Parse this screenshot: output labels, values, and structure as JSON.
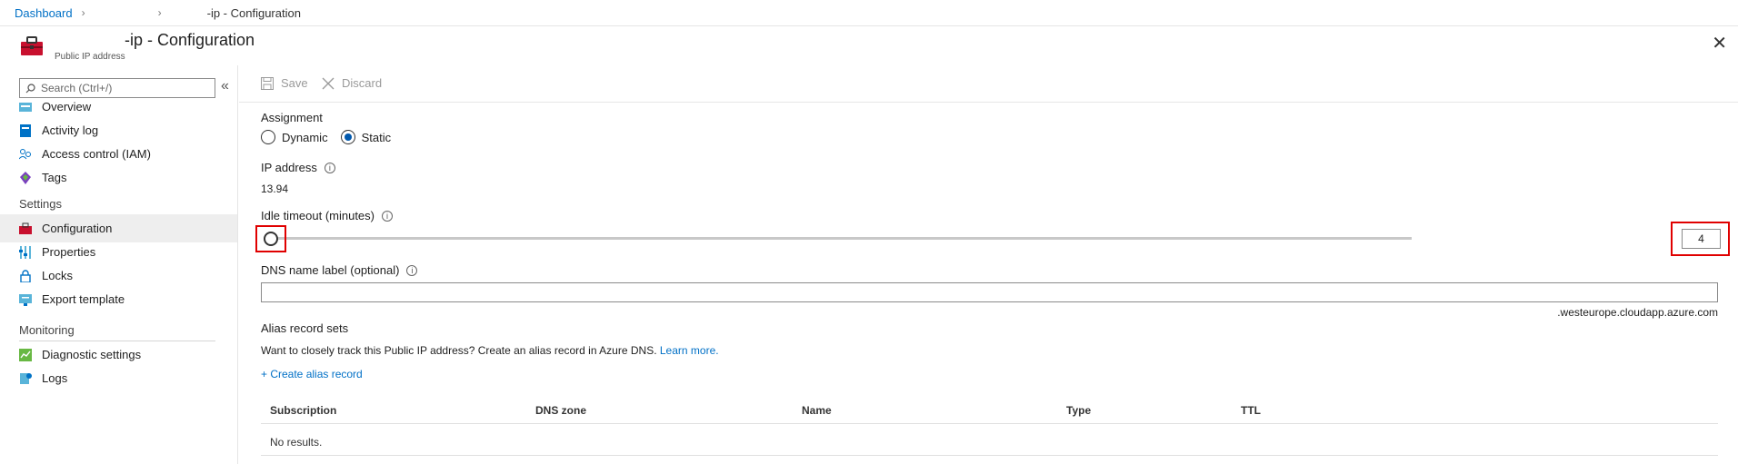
{
  "breadcrumb": {
    "root": "Dashboard",
    "current": "-ip - Configuration"
  },
  "header": {
    "title": "-ip - Configuration",
    "subtitle": "Public IP address"
  },
  "sidebar": {
    "search_placeholder": "Search (Ctrl+/)",
    "top_items": [
      {
        "label": "Overview",
        "icon": "overview-icon"
      },
      {
        "label": "Activity log",
        "icon": "activity-log-icon"
      },
      {
        "label": "Access control (IAM)",
        "icon": "iam-icon"
      },
      {
        "label": "Tags",
        "icon": "tag-icon"
      }
    ],
    "settings_heading": "Settings",
    "settings_items": [
      {
        "label": "Configuration",
        "icon": "toolbox-icon",
        "active": true
      },
      {
        "label": "Properties",
        "icon": "properties-icon"
      },
      {
        "label": "Locks",
        "icon": "lock-icon"
      },
      {
        "label": "Export template",
        "icon": "export-template-icon"
      }
    ],
    "monitoring_heading": "Monitoring",
    "monitoring_items": [
      {
        "label": "Diagnostic settings",
        "icon": "diagnostic-icon"
      },
      {
        "label": "Logs",
        "icon": "logs-icon"
      }
    ]
  },
  "toolbar": {
    "save": "Save",
    "discard": "Discard"
  },
  "form": {
    "assignment_label": "Assignment",
    "assignment_options": [
      "Dynamic",
      "Static"
    ],
    "assignment_selected": "Static",
    "ip_label": "IP address",
    "ip_value": "13.94",
    "idle_label": "Idle timeout (minutes)",
    "idle_value": "4",
    "dns_label": "DNS name label (optional)",
    "dns_value": "",
    "dns_suffix": ".westeurope.cloudapp.azure.com",
    "alias_heading": "Alias record sets",
    "alias_desc": "Want to closely track this Public IP address? Create an alias record in Azure DNS.",
    "learn_more": "Learn more.",
    "create_alias": "+ Create alias record"
  },
  "table": {
    "columns": [
      "Subscription",
      "DNS zone",
      "Name",
      "Type",
      "TTL"
    ],
    "empty": "No results."
  },
  "colors": {
    "link": "#0070c6",
    "radio_fill": "#0058ad",
    "highlight": "#e00000"
  }
}
